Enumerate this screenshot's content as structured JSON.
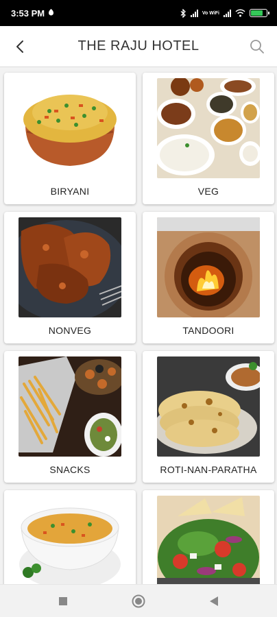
{
  "status_bar": {
    "time": "3:53 PM",
    "network_label": "Vo WiFi",
    "battery_level": 0.75
  },
  "header": {
    "title": "THE RAJU HOTEL"
  },
  "categories": [
    {
      "label": "BIRYANI"
    },
    {
      "label": "VEG"
    },
    {
      "label": "NONVEG"
    },
    {
      "label": "TANDOORI"
    },
    {
      "label": "SNACKS"
    },
    {
      "label": "ROTI-NAN-PARATHA"
    },
    {
      "label": ""
    },
    {
      "label": ""
    }
  ],
  "colors": {
    "status_bar_bg": "#000000",
    "header_bg": "#ffffff",
    "page_bg": "#f2f2f2",
    "battery_fill": "#35c759"
  },
  "icons": {
    "back": "chevron-left-icon",
    "search": "search-icon",
    "nav_recents": "square-icon",
    "nav_home": "circle-icon",
    "nav_back": "triangle-icon"
  }
}
